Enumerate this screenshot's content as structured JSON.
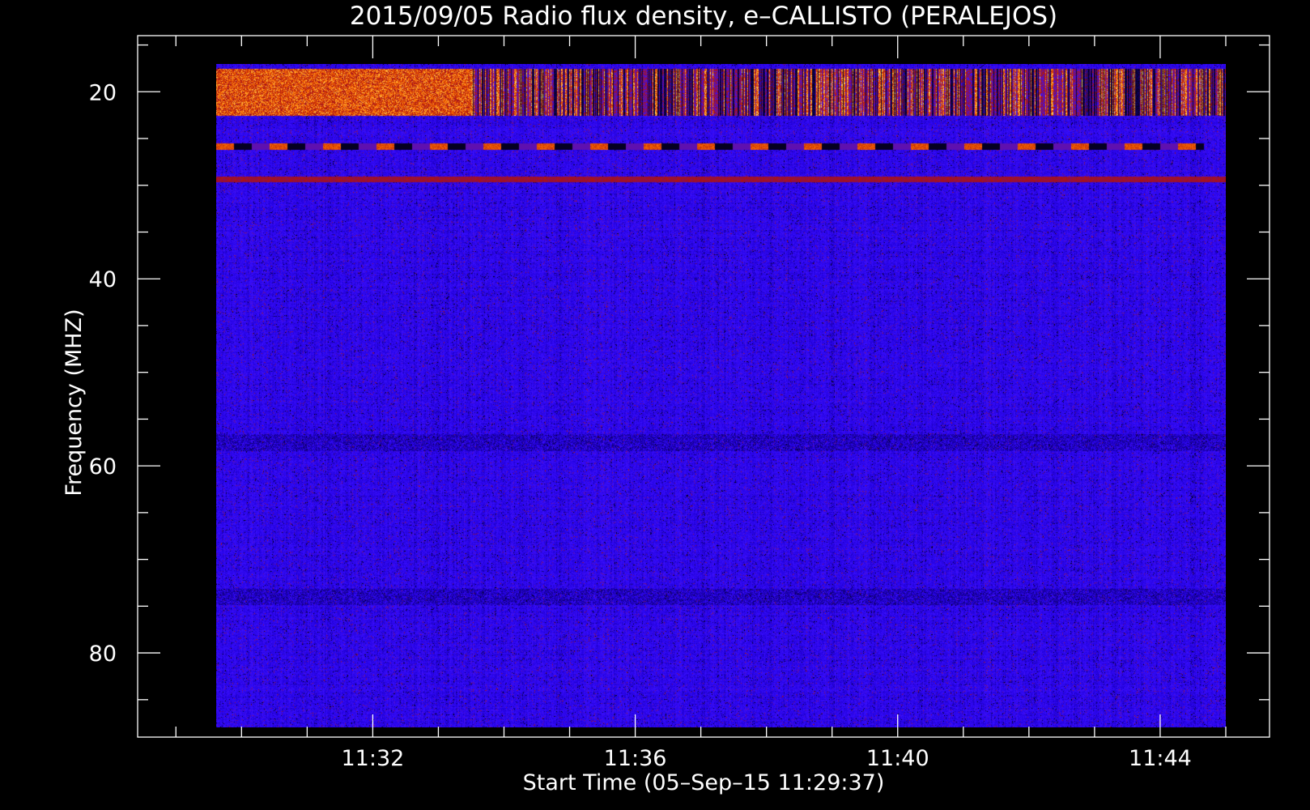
{
  "chart_data": {
    "type": "heatmap",
    "title": "2015/09/05  Radio flux density, e–CALLISTO (PERALEJOS)",
    "xlabel": "Start Time (05–Sep–15 11:29:37)",
    "ylabel": "Frequency (MHZ)",
    "x_start": "11:29:37",
    "x_end": "11:45:00",
    "xlim": [
      "11:28:25",
      "11:45:40"
    ],
    "ylim": [
      89,
      14
    ],
    "y_direction": "increasing-downward",
    "x_ticks": [
      "11:32",
      "11:36",
      "11:40",
      "11:44"
    ],
    "y_ticks": [
      20,
      40,
      60,
      80
    ],
    "x_minor_step_seconds": 60,
    "y_minor_step": 5,
    "freq_range": [
      17,
      88
    ],
    "colormap": [
      "#000000",
      "#2200dd",
      "#3a10ff",
      "#aa1010",
      "#ff7000",
      "#ffff80"
    ],
    "background_level": "blue",
    "features": [
      {
        "name": "strong emission band",
        "freq_range": [
          17.5,
          22.5
        ],
        "time_range": [
          "11:29:37",
          "11:33:30"
        ],
        "level": "yellow-orange"
      },
      {
        "name": "intermittent emission band",
        "freq_range": [
          17.5,
          22.5
        ],
        "time_range": [
          "11:33:30",
          "11:45:00"
        ],
        "level": "red-black"
      },
      {
        "name": "interference line",
        "freq": 25.8,
        "time_range": [
          "11:29:37",
          "11:44:40"
        ],
        "level": "dashed red-black"
      },
      {
        "name": "weak line",
        "freq": 29.3,
        "time_range": [
          "11:29:37",
          "11:45:00"
        ],
        "level": "red"
      },
      {
        "name": "dark band",
        "freq": 57.5,
        "time_range": [
          "11:29:37",
          "11:45:00"
        ],
        "level": "black"
      },
      {
        "name": "dark band",
        "freq": 74,
        "time_range": [
          "11:29:37",
          "11:45:00"
        ],
        "level": "black"
      }
    ]
  }
}
